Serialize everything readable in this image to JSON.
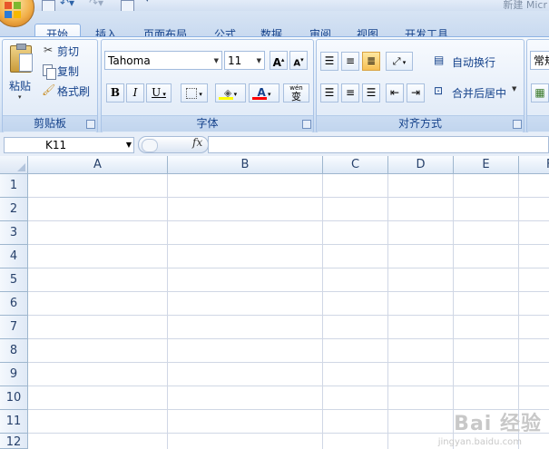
{
  "window": {
    "title": "新建 Micr",
    "quick_access": [
      "save-icon",
      "undo-icon",
      "redo-icon",
      "print-preview-icon"
    ]
  },
  "tabs": [
    {
      "label": "开始",
      "active": true
    },
    {
      "label": "插入"
    },
    {
      "label": "页面布局"
    },
    {
      "label": "公式"
    },
    {
      "label": "数据"
    },
    {
      "label": "审阅"
    },
    {
      "label": "视图"
    },
    {
      "label": "开发工具"
    }
  ],
  "ribbon": {
    "clipboard": {
      "paste": "粘贴",
      "cut": "剪切",
      "copy": "复制",
      "format_painter": "格式刷",
      "group_label": "剪贴板"
    },
    "font": {
      "font_name": "Tahoma",
      "font_size": "11",
      "grow": "A",
      "shrink": "A",
      "bold": "B",
      "italic": "I",
      "underline": "U",
      "phonetic": "wén",
      "phonetic_char": "变",
      "group_label": "字体"
    },
    "alignment": {
      "wrap_text": "自动换行",
      "merge_center": "合并后居中",
      "group_label": "对齐方式"
    },
    "number": {
      "format": "常规"
    }
  },
  "formula_bar": {
    "name_box": "K11",
    "fx": "fx",
    "value": ""
  },
  "sheet": {
    "columns": [
      "A",
      "B",
      "C",
      "D",
      "E",
      "F"
    ],
    "rows": [
      "1",
      "2",
      "3",
      "4",
      "5",
      "6",
      "7",
      "8",
      "9",
      "10",
      "11",
      "12"
    ]
  },
  "watermark": {
    "text": "Bai 经验",
    "sub": "jingyan.baidu.com"
  },
  "colors": {
    "ribbon_text": "#15428b",
    "active_tab_border": "#8db2e3",
    "highlight_yellow": "#f7c054",
    "font_color_red": "#ff0000",
    "fill_yellow": "#ffff00"
  }
}
